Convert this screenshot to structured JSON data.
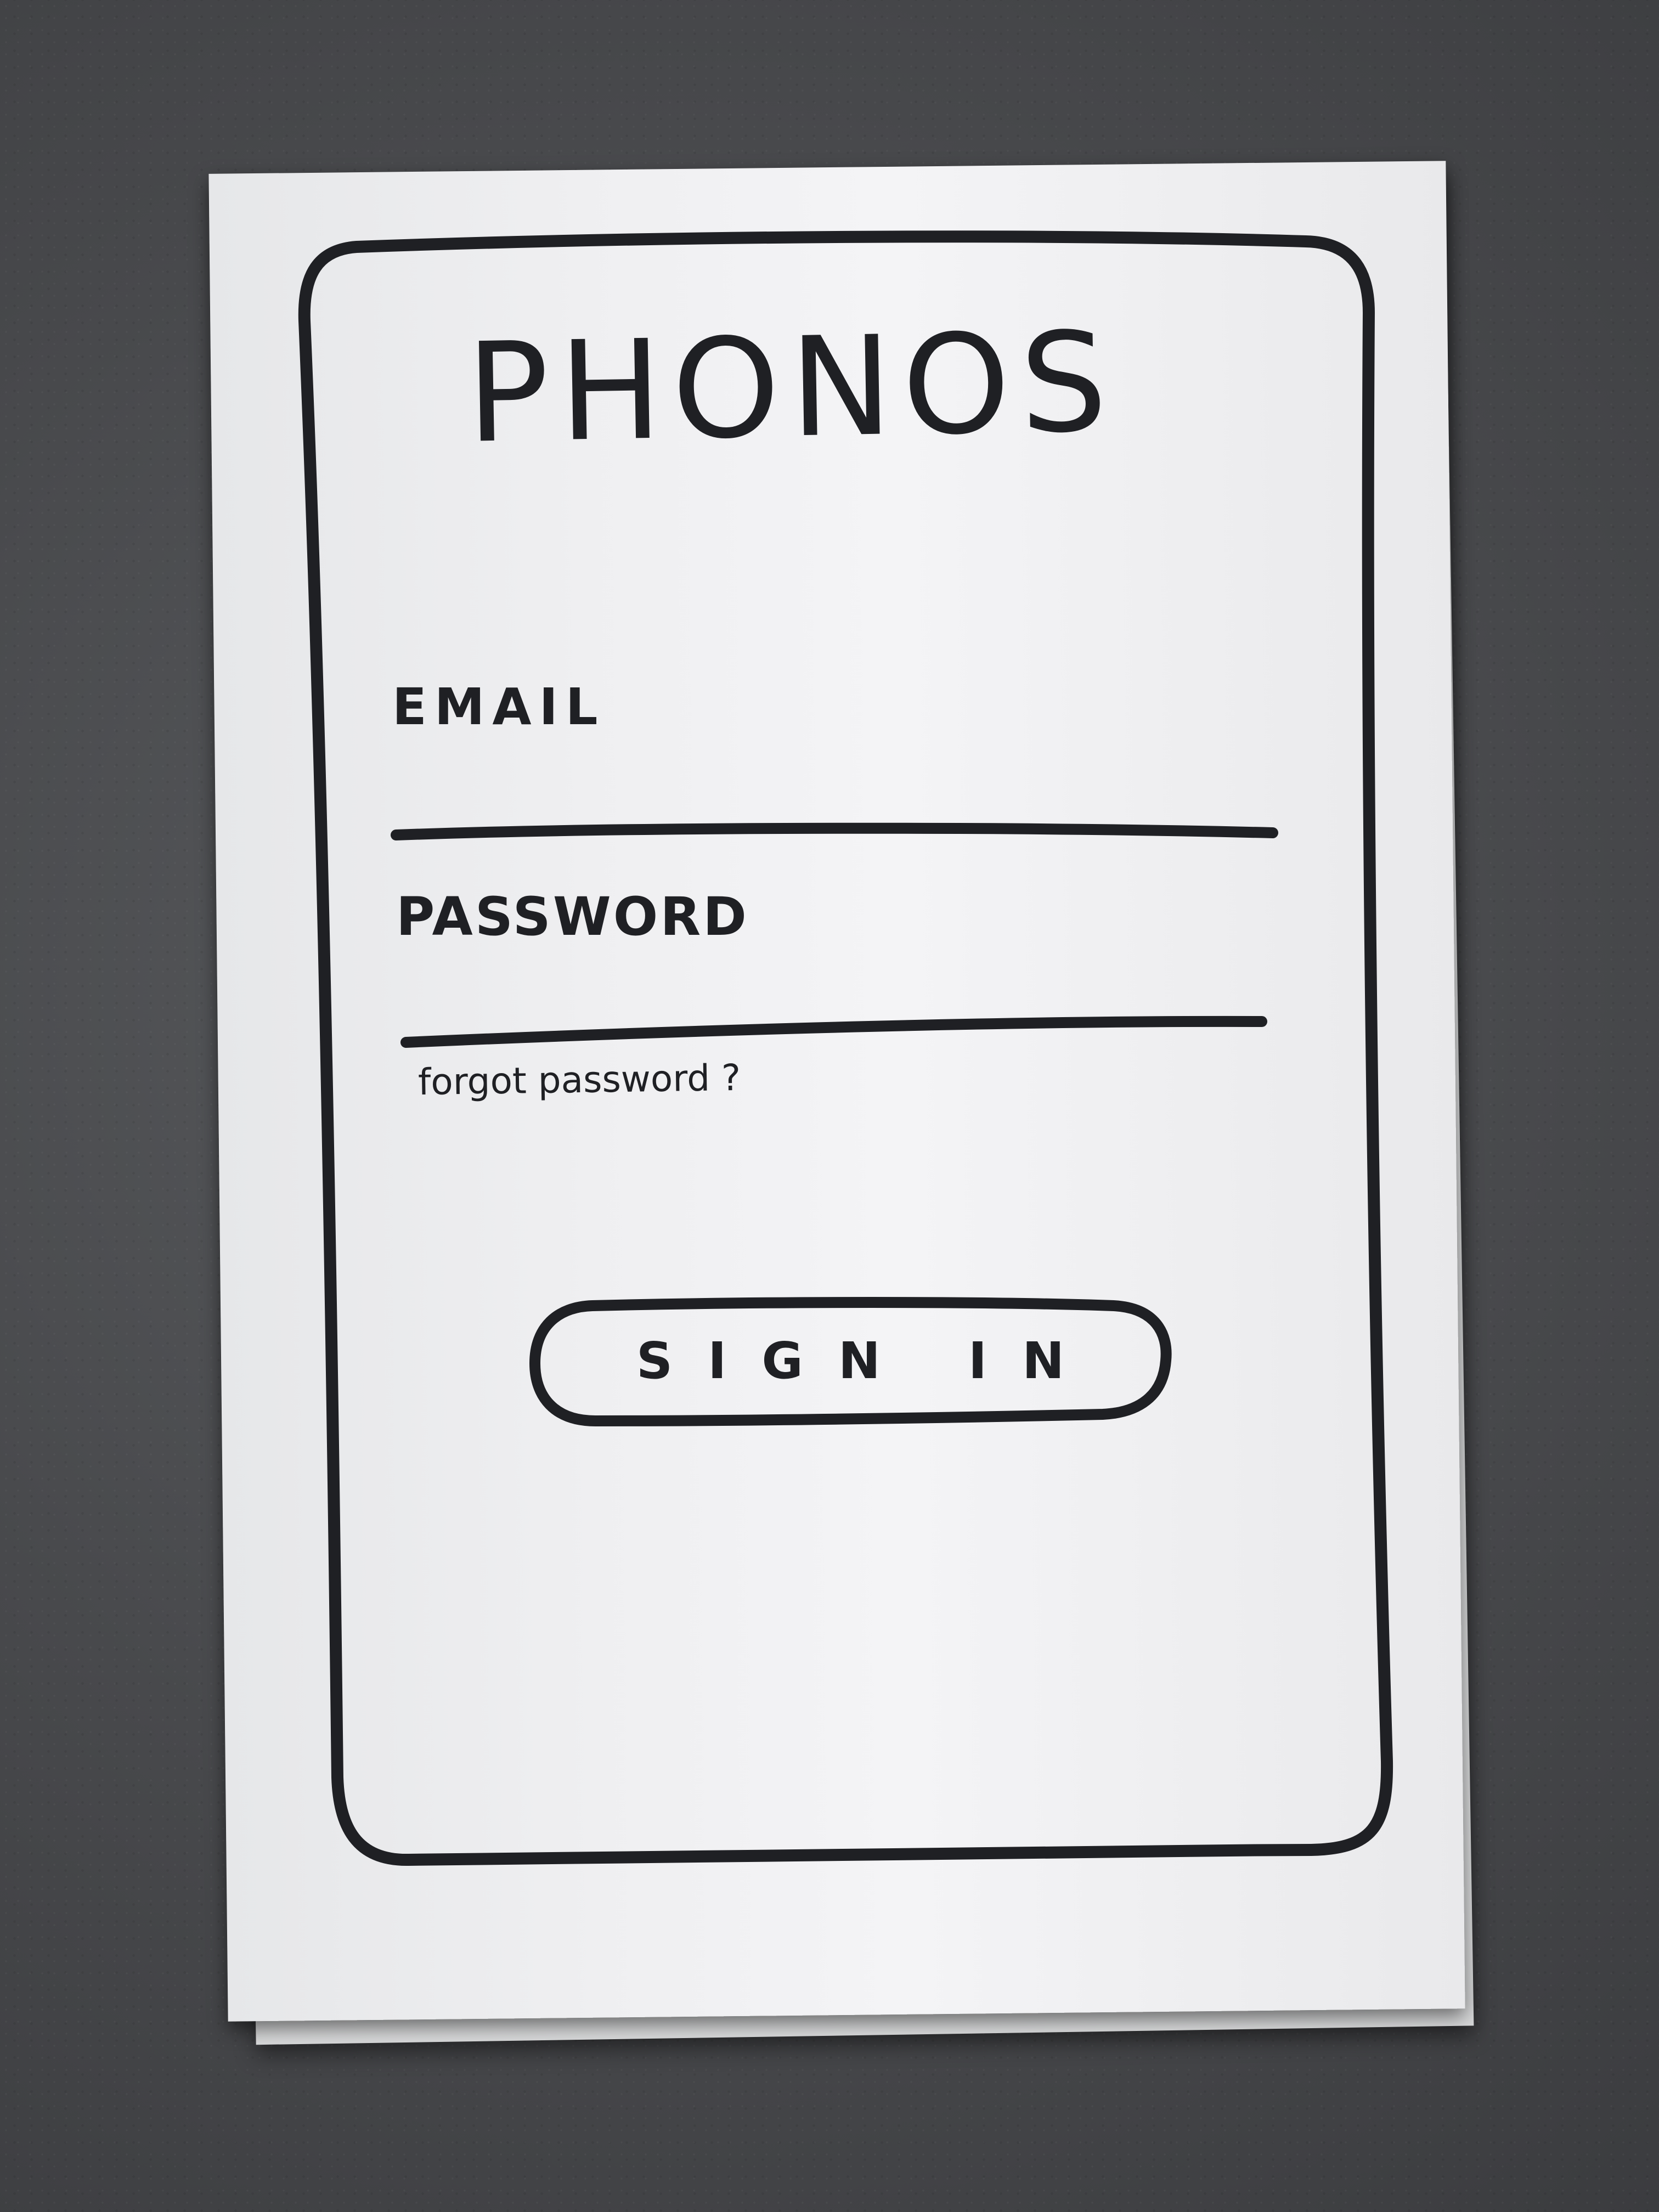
{
  "app": {
    "title": "PHONOS"
  },
  "login_form": {
    "email_label": "EMAIL",
    "email_value": "",
    "password_label": "PASSWORD",
    "password_value": "",
    "forgot_password_link": "forgot password ?",
    "sign_in_button": "SIGN IN"
  },
  "colors": {
    "ink": "#1f2024",
    "paper": "#eeeef0",
    "background": "#4a4b4e"
  }
}
